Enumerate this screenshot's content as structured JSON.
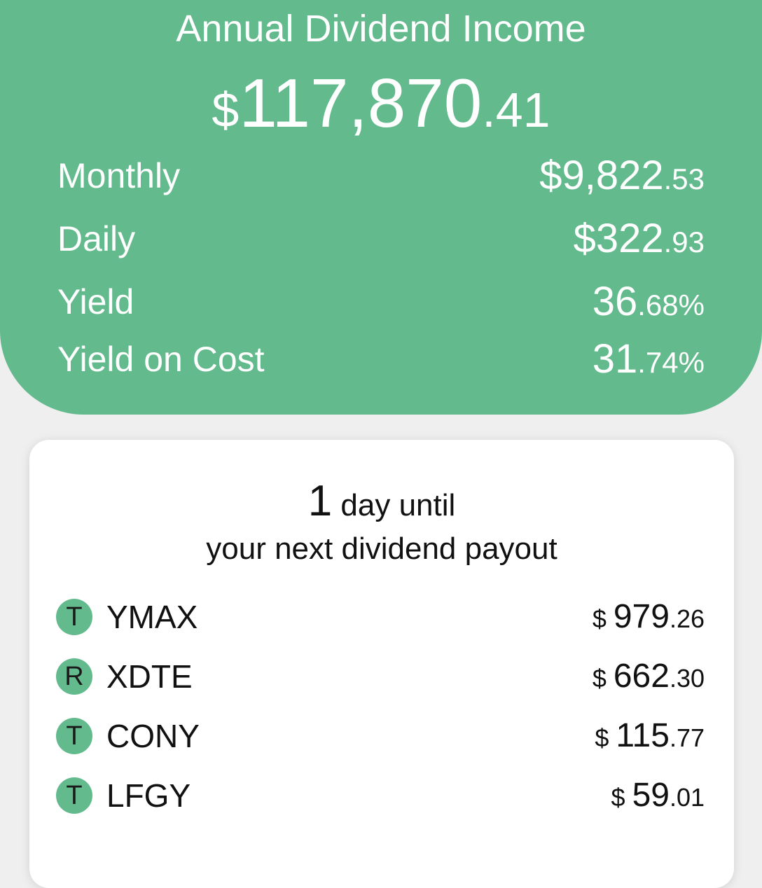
{
  "summary": {
    "title": "Annual Dividend Income",
    "total": {
      "currency": "$",
      "whole": "117,870",
      "fraction": ".41"
    },
    "metrics": [
      {
        "label": "Monthly",
        "whole": "$9,822",
        "fraction": ".53"
      },
      {
        "label": "Daily",
        "whole": "$322",
        "fraction": ".93"
      },
      {
        "label": "Yield",
        "whole": "36",
        "fraction": ".68%"
      },
      {
        "label": "Yield on Cost",
        "whole": "31",
        "fraction": ".74%"
      }
    ]
  },
  "next_payout": {
    "count": "1",
    "count_unit": " day until",
    "subtitle": "your next dividend payout",
    "holdings": [
      {
        "badge": "T",
        "ticker": "YMAX",
        "currency": "$",
        "whole": "979",
        "fraction": ".26"
      },
      {
        "badge": "R",
        "ticker": "XDTE",
        "currency": "$",
        "whole": "662",
        "fraction": ".30"
      },
      {
        "badge": "T",
        "ticker": "CONY",
        "currency": "$",
        "whole": "115",
        "fraction": ".77"
      },
      {
        "badge": "T",
        "ticker": "LFGY",
        "currency": "$",
        "whole": "59",
        "fraction": ".01"
      }
    ]
  },
  "colors": {
    "accent": "#63ba8d",
    "background": "#efefef",
    "card": "#ffffff"
  }
}
